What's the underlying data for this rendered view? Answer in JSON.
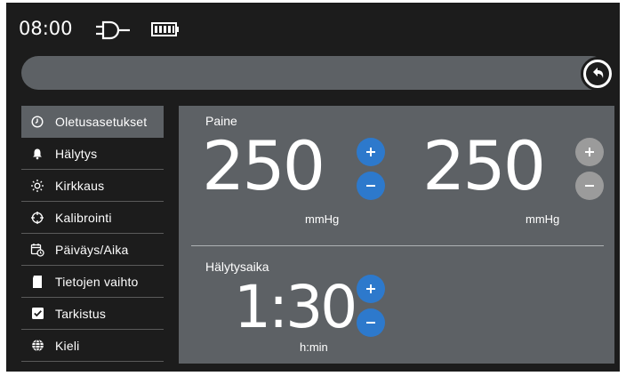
{
  "status": {
    "time": "08:00",
    "icons": [
      "power-plug-icon",
      "battery-icon"
    ]
  },
  "titlebar": {
    "title": "",
    "back_icon": "back-arrow-icon"
  },
  "sidebar": {
    "items": [
      {
        "label": "Oletusasetukset",
        "icon": "clock-icon",
        "active": true
      },
      {
        "label": "Hälytys",
        "icon": "bell-icon"
      },
      {
        "label": "Kirkkaus",
        "icon": "brightness-icon"
      },
      {
        "label": "Kalibrointi",
        "icon": "crosshair-icon"
      },
      {
        "label": "Päiväys/Aika",
        "icon": "calendar-clock-icon"
      },
      {
        "label": "Tietojen vaihto",
        "icon": "sd-card-icon"
      },
      {
        "label": "Tarkistus",
        "icon": "checkbox-icon"
      },
      {
        "label": "Kieli",
        "icon": "globe-icon"
      }
    ]
  },
  "main": {
    "pressure": {
      "label": "Paine",
      "left": {
        "value": "250",
        "unit": "mmHg"
      },
      "right": {
        "value": "250",
        "unit": "mmHg"
      }
    },
    "alarm_time": {
      "label": "Hälytysaika",
      "value": "1:30",
      "unit": "h:min"
    }
  },
  "colors": {
    "background": "#1c1c1c",
    "panel": "#5d6165",
    "accent_blue": "#2d79cc",
    "disabled_grey": "#9b9b9b"
  }
}
